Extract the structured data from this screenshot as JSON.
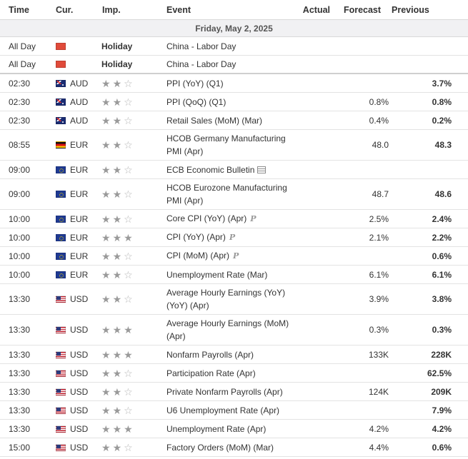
{
  "header": {
    "time": "Time",
    "currency": "Cur.",
    "importance": "Imp.",
    "event": "Event",
    "actual": "Actual",
    "forecast": "Forecast",
    "previous": "Previous"
  },
  "date_label": "Friday, May 2, 2025",
  "rows": [
    {
      "time": "All Day",
      "flag": "cn",
      "currency": "",
      "importance": "Holiday",
      "event": "China - Labor Day",
      "actual": "",
      "forecast": "",
      "previous": ""
    },
    {
      "time": "All Day",
      "flag": "cn",
      "currency": "",
      "importance": "Holiday",
      "event": "China - Labor Day",
      "actual": "",
      "forecast": "",
      "previous": ""
    },
    {
      "time": "02:30",
      "flag": "au",
      "currency": "AUD",
      "stars": 2,
      "event": "PPI (YoY) (Q1)",
      "actual": "",
      "forecast": "",
      "previous": "3.7%"
    },
    {
      "time": "02:30",
      "flag": "au",
      "currency": "AUD",
      "stars": 2,
      "event": "PPI (QoQ) (Q1)",
      "actual": "",
      "forecast": "0.8%",
      "previous": "0.8%"
    },
    {
      "time": "02:30",
      "flag": "au",
      "currency": "AUD",
      "stars": 2,
      "event": "Retail Sales (MoM) (Mar)",
      "actual": "",
      "forecast": "0.4%",
      "previous": "0.2%"
    },
    {
      "time": "08:55",
      "flag": "de",
      "currency": "EUR",
      "stars": 2,
      "event": "HCOB Germany Manufacturing PMI (Apr)",
      "actual": "",
      "forecast": "48.0",
      "previous": "48.3"
    },
    {
      "time": "09:00",
      "flag": "eu",
      "currency": "EUR",
      "stars": 2,
      "event": "ECB Economic Bulletin",
      "icon": "document-icon",
      "actual": "",
      "forecast": "",
      "previous": ""
    },
    {
      "time": "09:00",
      "flag": "eu",
      "currency": "EUR",
      "stars": 2,
      "event": "HCOB Eurozone Manufacturing PMI (Apr)",
      "actual": "",
      "forecast": "48.7",
      "previous": "48.6"
    },
    {
      "time": "10:00",
      "flag": "eu",
      "currency": "EUR",
      "stars": 2,
      "event": "Core CPI (YoY) (Apr)",
      "icon": "preliminary-icon",
      "actual": "",
      "forecast": "2.5%",
      "previous": "2.4%"
    },
    {
      "time": "10:00",
      "flag": "eu",
      "currency": "EUR",
      "stars": 3,
      "event": "CPI (YoY) (Apr)",
      "icon": "preliminary-icon",
      "actual": "",
      "forecast": "2.1%",
      "previous": "2.2%"
    },
    {
      "time": "10:00",
      "flag": "eu",
      "currency": "EUR",
      "stars": 2,
      "event": "CPI (MoM) (Apr)",
      "icon": "preliminary-icon",
      "actual": "",
      "forecast": "",
      "previous": "0.6%"
    },
    {
      "time": "10:00",
      "flag": "eu",
      "currency": "EUR",
      "stars": 2,
      "event": "Unemployment Rate (Mar)",
      "actual": "",
      "forecast": "6.1%",
      "previous": "6.1%"
    },
    {
      "time": "13:30",
      "flag": "us",
      "currency": "USD",
      "stars": 2,
      "event": "Average Hourly Earnings (YoY) (YoY) (Apr)",
      "actual": "",
      "forecast": "3.9%",
      "previous": "3.8%"
    },
    {
      "time": "13:30",
      "flag": "us",
      "currency": "USD",
      "stars": 3,
      "event": "Average Hourly Earnings (MoM) (Apr)",
      "actual": "",
      "forecast": "0.3%",
      "previous": "0.3%"
    },
    {
      "time": "13:30",
      "flag": "us",
      "currency": "USD",
      "stars": 3,
      "event": "Nonfarm Payrolls (Apr)",
      "actual": "",
      "forecast": "133K",
      "previous": "228K"
    },
    {
      "time": "13:30",
      "flag": "us",
      "currency": "USD",
      "stars": 2,
      "event": "Participation Rate (Apr)",
      "actual": "",
      "forecast": "",
      "previous": "62.5%"
    },
    {
      "time": "13:30",
      "flag": "us",
      "currency": "USD",
      "stars": 2,
      "event": "Private Nonfarm Payrolls (Apr)",
      "actual": "",
      "forecast": "124K",
      "previous": "209K"
    },
    {
      "time": "13:30",
      "flag": "us",
      "currency": "USD",
      "stars": 2,
      "event": "U6 Unemployment Rate (Apr)",
      "actual": "",
      "forecast": "",
      "previous": "7.9%"
    },
    {
      "time": "13:30",
      "flag": "us",
      "currency": "USD",
      "stars": 3,
      "event": "Unemployment Rate (Apr)",
      "actual": "",
      "forecast": "4.2%",
      "previous": "4.2%"
    },
    {
      "time": "15:00",
      "flag": "us",
      "currency": "USD",
      "stars": 2,
      "event": "Factory Orders (MoM) (Mar)",
      "actual": "",
      "forecast": "4.4%",
      "previous": "0.6%"
    }
  ]
}
